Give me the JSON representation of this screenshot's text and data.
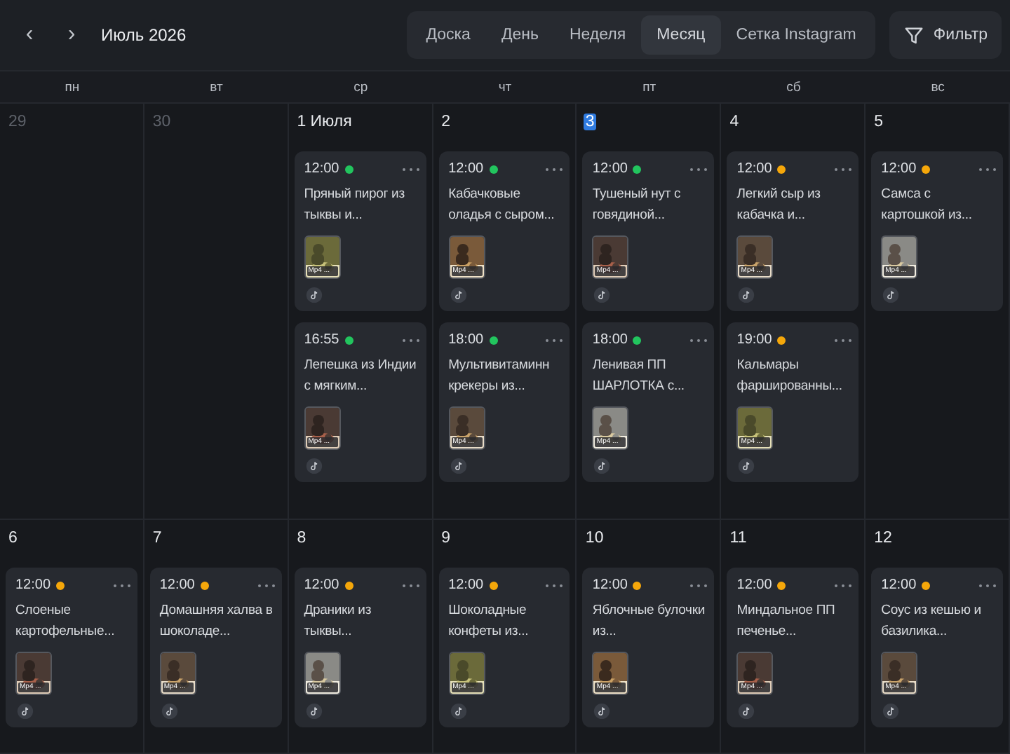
{
  "header": {
    "prev": "‹",
    "next": "›",
    "month": "Июль 2026"
  },
  "views": [
    {
      "label": "Доска",
      "selected": false
    },
    {
      "label": "День",
      "selected": false
    },
    {
      "label": "Неделя",
      "selected": false
    },
    {
      "label": "Месяц",
      "selected": true
    },
    {
      "label": "Сетка Instagram",
      "selected": false
    }
  ],
  "filter": {
    "label": "Фильтр"
  },
  "weekdays": [
    "пн",
    "вт",
    "ср",
    "чт",
    "пт",
    "сб",
    "вс"
  ],
  "weeks": [
    {
      "days": [
        {
          "label": "29",
          "muted": true,
          "today": false
        },
        {
          "label": "30",
          "muted": true,
          "today": false
        },
        {
          "label": "1 Июля",
          "muted": false,
          "today": false,
          "posts": [
            {
              "time": "12:00",
              "color": "#22c55e",
              "title": "Пряный пирог из тыквы и...",
              "badge": "Mp4 ..."
            },
            {
              "time": "16:55",
              "color": "#22c55e",
              "title": "Лепешка из Индии с мягким...",
              "badge": "Mp4 ..."
            }
          ]
        },
        {
          "label": "2",
          "muted": false,
          "today": false,
          "posts": [
            {
              "time": "12:00",
              "color": "#22c55e",
              "title": "Кабачковые оладья с сыром...",
              "badge": "Mp4 ..."
            },
            {
              "time": "18:00",
              "color": "#22c55e",
              "title": "Мультивитаминн крекеры из...",
              "badge": "Mp4 ..."
            }
          ]
        },
        {
          "label": "3",
          "muted": false,
          "today": true,
          "posts": [
            {
              "time": "12:00",
              "color": "#22c55e",
              "title": "Тушеный нут с говядиной...",
              "badge": "Mp4 ..."
            },
            {
              "time": "18:00",
              "color": "#22c55e",
              "title": "Ленивая ПП ШАРЛОТКА с...",
              "badge": "Mp4 ..."
            }
          ]
        },
        {
          "label": "4",
          "muted": false,
          "today": false,
          "posts": [
            {
              "time": "12:00",
              "color": "#f5a70a",
              "title": "Легкий сыр из кабачка и...",
              "badge": "Mp4 ..."
            },
            {
              "time": "19:00",
              "color": "#f5a70a",
              "title": "Кальмары фаршированны...",
              "badge": "Mp4 ..."
            }
          ]
        },
        {
          "label": "5",
          "muted": false,
          "today": false,
          "posts": [
            {
              "time": "12:00",
              "color": "#f5a70a",
              "title": "Самса с картошкой из...",
              "badge": "Mp4 ..."
            }
          ]
        }
      ]
    },
    {
      "days": [
        {
          "label": "6",
          "muted": false,
          "today": false,
          "posts": [
            {
              "time": "12:00",
              "color": "#f5a70a",
              "title": "Слоеные картофельные...",
              "badge": "Mp4 ..."
            }
          ]
        },
        {
          "label": "7",
          "muted": false,
          "today": false,
          "posts": [
            {
              "time": "12:00",
              "color": "#f5a70a",
              "title": "Домашняя халва в шоколаде...",
              "badge": "Mp4 ..."
            }
          ]
        },
        {
          "label": "8",
          "muted": false,
          "today": false,
          "posts": [
            {
              "time": "12:00",
              "color": "#f5a70a",
              "title": "Драники из тыквы...",
              "badge": "Mp4 ..."
            }
          ]
        },
        {
          "label": "9",
          "muted": false,
          "today": false,
          "posts": [
            {
              "time": "12:00",
              "color": "#f5a70a",
              "title": "Шоколадные конфеты из...",
              "badge": "Mp4 ..."
            }
          ]
        },
        {
          "label": "10",
          "muted": false,
          "today": false,
          "posts": [
            {
              "time": "12:00",
              "color": "#f5a70a",
              "title": "Яблочные булочки из...",
              "badge": "Mp4 ..."
            }
          ]
        },
        {
          "label": "11",
          "muted": false,
          "today": false,
          "posts": [
            {
              "time": "12:00",
              "color": "#f5a70a",
              "title": "Миндальное ПП печенье...",
              "badge": "Mp4 ..."
            }
          ]
        },
        {
          "label": "12",
          "muted": false,
          "today": false,
          "posts": [
            {
              "time": "12:00",
              "color": "#f5a70a",
              "title": "Соус из кешью и базилика...",
              "badge": "Mp4 ..."
            }
          ]
        }
      ]
    }
  ]
}
